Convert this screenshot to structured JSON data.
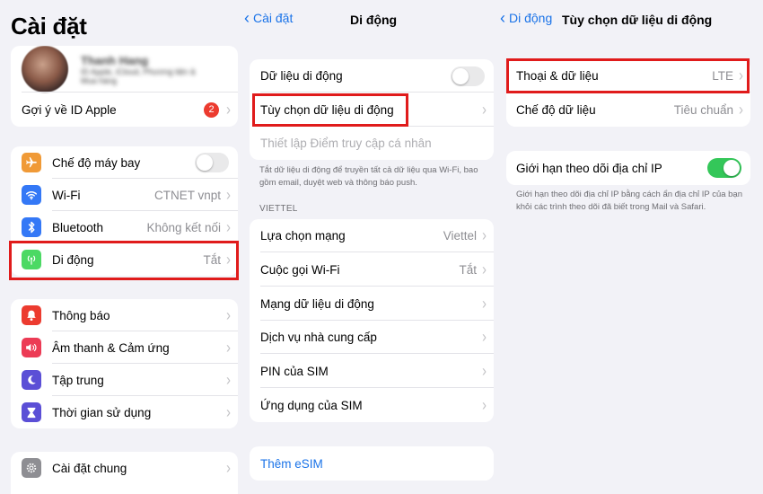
{
  "settings": {
    "title": "Cài đặt",
    "profile": {
      "name": "Thanh Hang",
      "subtitle_1": "ID Apple, iCloud, Phương tiện &",
      "subtitle_2": "Mua hàng"
    },
    "apple_id_suggest": {
      "label": "Gợi ý về ID Apple",
      "badge": "2"
    },
    "airplane": {
      "label": "Chế độ máy bay"
    },
    "wifi": {
      "label": "Wi-Fi",
      "value": "CTNET vnpt"
    },
    "bluetooth": {
      "label": "Bluetooth",
      "value": "Không kết nối"
    },
    "mobile": {
      "label": "Di động",
      "value": "Tắt"
    },
    "notifications": {
      "label": "Thông báo"
    },
    "sounds": {
      "label": "Âm thanh & Cảm ứng"
    },
    "focus": {
      "label": "Tập trung"
    },
    "screen_time": {
      "label": "Thời gian sử dụng"
    },
    "general": {
      "label": "Cài đặt chung"
    }
  },
  "mobile": {
    "back": "Cài đặt",
    "title": "Di động",
    "cellular_data": {
      "label": "Dữ liệu di động"
    },
    "data_options": {
      "label": "Tùy chọn dữ liệu di động"
    },
    "hotspot": {
      "label": "Thiết lập Điểm truy cập cá nhân"
    },
    "footnote": "Tắt dữ liệu di động để truyền tất cả dữ liệu qua Wi-Fi, bao gồm email, duyệt web và thông báo push.",
    "section": "VIETTEL",
    "network": {
      "label": "Lựa chọn mạng",
      "value": "Viettel"
    },
    "wifi_calling": {
      "label": "Cuộc gọi Wi-Fi",
      "value": "Tắt"
    },
    "cellular_network": {
      "label": "Mạng dữ liệu di động"
    },
    "carrier_services": {
      "label": "Dịch vụ nhà cung cấp"
    },
    "sim_pin": {
      "label": "PIN của SIM"
    },
    "sim_apps": {
      "label": "Ứng dụng của SIM"
    },
    "add_esim": {
      "label": "Thêm eSIM"
    }
  },
  "data_options": {
    "back": "Di động",
    "title": "Tùy chọn dữ liệu di động",
    "voice_data": {
      "label": "Thoại & dữ liệu",
      "value": "LTE"
    },
    "data_mode": {
      "label": "Chế độ dữ liệu",
      "value": "Tiêu chuẩn"
    },
    "limit_ip": {
      "label": "Giới hạn theo dõi địa chỉ IP"
    },
    "footnote": "Giới hạn theo dõi địa chỉ IP bằng cách ẩn địa chỉ IP của bạn khỏi các trình theo dõi đã biết trong Mail và Safari."
  },
  "colors": {
    "accent": "#1a73e8",
    "highlight": "#e01b1b",
    "toggle_on": "#34c759",
    "airplane_icon": "#f09a37",
    "wifi_icon": "#3478f6",
    "bluetooth_icon": "#3478f6",
    "mobile_icon": "#4cd964",
    "notifications_icon": "#ec3b2f",
    "sounds_icon": "#ec3b55",
    "focus_icon": "#5b4fd6",
    "screen_time_icon": "#5b4fd6",
    "general_icon": "#8e8e93"
  },
  "icons": [
    "airplane-icon",
    "wifi-icon",
    "bluetooth-icon",
    "antenna-icon",
    "bell-icon",
    "speaker-icon",
    "moon-icon",
    "hourglass-icon",
    "gear-icon"
  ]
}
